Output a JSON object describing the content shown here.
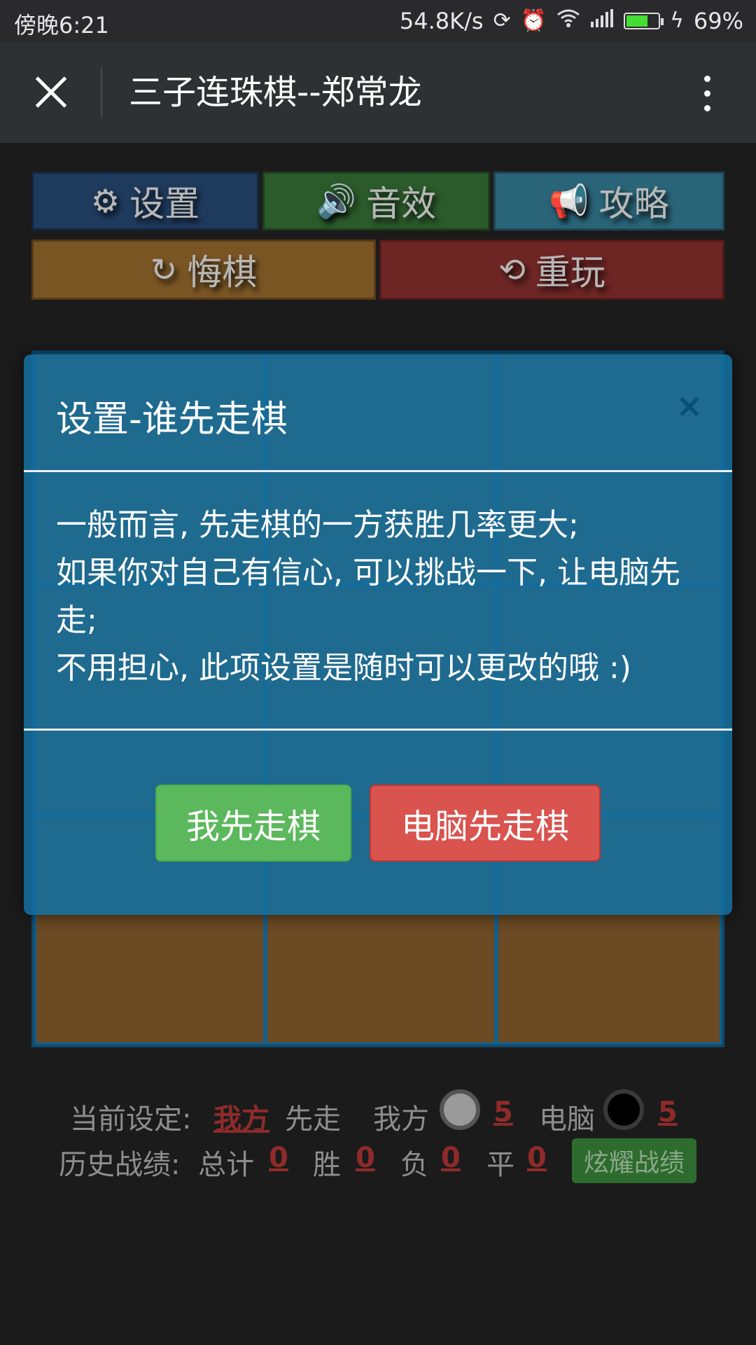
{
  "status_bar": {
    "time": "傍晚6:21",
    "speed": "54.8K/s",
    "battery_percent": "69%",
    "battery_level": 0.69,
    "icons": [
      "sync-icon",
      "alarm-icon",
      "wifi-icon",
      "signal-icon",
      "battery-icon",
      "charging-icon"
    ]
  },
  "title_bar": {
    "title": "三子连珠棋--郑常龙",
    "close_icon": "close-icon",
    "more_icon": "more-vertical-icon"
  },
  "toolbar": {
    "settings_label": "设置",
    "sound_label": "音效",
    "guide_label": "攻略",
    "undo_label": "悔棋",
    "replay_label": "重玩",
    "colors": {
      "settings": "#1e3a5c",
      "sound": "#2b5a2b",
      "guide": "#2a6478",
      "undo": "#7a5524",
      "replay": "#6e2624"
    }
  },
  "dialog": {
    "title": "设置-谁先走棋",
    "close_symbol": "×",
    "body": [
      "一般而言, 先走棋的一方获胜几率更大;",
      "如果你对自己有信心, 可以挑战一下, 让电脑先走;",
      "不用担心, 此项设置是随时可以更改的哦 :)"
    ],
    "me_first_label": "我先走棋",
    "computer_first_label": "电脑先走棋",
    "colors": {
      "me_first": "#5cb85c",
      "computer_first": "#d9534f",
      "panel": "#146e9e"
    }
  },
  "info": {
    "current_label": "当前设定:",
    "current_side": "我方",
    "first_text": "先走",
    "me_label": "我方",
    "me_count": "5",
    "computer_label": "电脑",
    "computer_count": "5",
    "history_label": "历史战绩:",
    "total_label": "总计",
    "total_value": "0",
    "win_label": "胜",
    "win_value": "0",
    "lose_label": "负",
    "lose_value": "0",
    "draw_label": "平",
    "draw_value": "0",
    "show_off_label": "炫耀战绩"
  }
}
